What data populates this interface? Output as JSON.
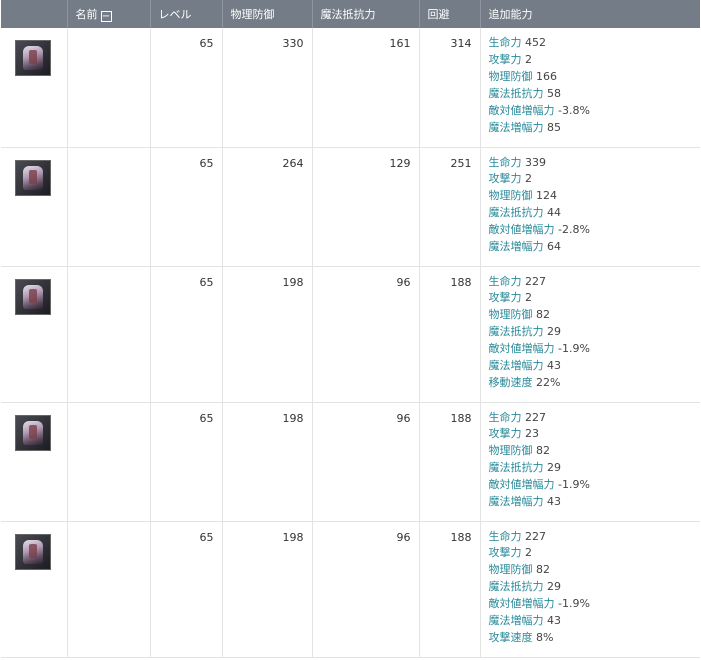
{
  "columns": {
    "name": "名前",
    "level": "レベル",
    "phys_def": "物理防御",
    "mag_res": "魔法抵抗力",
    "evasion": "回避",
    "bonus": "追加能力"
  },
  "toggle_symbol": "−",
  "rows": [
    {
      "icon": "armor-piece-icon",
      "level": "65",
      "phys_def": "330",
      "mag_res": "161",
      "evasion": "314",
      "stats": [
        {
          "k": "生命力",
          "v": "452"
        },
        {
          "k": "攻撃力",
          "v": "2"
        },
        {
          "k": "物理防御",
          "v": "166"
        },
        {
          "k": "魔法抵抗力",
          "v": "58"
        },
        {
          "k": "敵対値増幅力",
          "v": "-3.8%"
        },
        {
          "k": "魔法増幅力",
          "v": "85"
        }
      ]
    },
    {
      "icon": "armor-piece-icon",
      "level": "65",
      "phys_def": "264",
      "mag_res": "129",
      "evasion": "251",
      "stats": [
        {
          "k": "生命力",
          "v": "339"
        },
        {
          "k": "攻撃力",
          "v": "2"
        },
        {
          "k": "物理防御",
          "v": "124"
        },
        {
          "k": "魔法抵抗力",
          "v": "44"
        },
        {
          "k": "敵対値増幅力",
          "v": "-2.8%"
        },
        {
          "k": "魔法増幅力",
          "v": "64"
        }
      ]
    },
    {
      "icon": "armor-piece-icon",
      "level": "65",
      "phys_def": "198",
      "mag_res": "96",
      "evasion": "188",
      "stats": [
        {
          "k": "生命力",
          "v": "227"
        },
        {
          "k": "攻撃力",
          "v": "2"
        },
        {
          "k": "物理防御",
          "v": "82"
        },
        {
          "k": "魔法抵抗力",
          "v": "29"
        },
        {
          "k": "敵対値増幅力",
          "v": "-1.9%"
        },
        {
          "k": "魔法増幅力",
          "v": "43"
        },
        {
          "k": "移動速度",
          "v": "22%"
        }
      ]
    },
    {
      "icon": "armor-piece-icon",
      "level": "65",
      "phys_def": "198",
      "mag_res": "96",
      "evasion": "188",
      "stats": [
        {
          "k": "生命力",
          "v": "227"
        },
        {
          "k": "攻撃力",
          "v": "23"
        },
        {
          "k": "物理防御",
          "v": "82"
        },
        {
          "k": "魔法抵抗力",
          "v": "29"
        },
        {
          "k": "敵対値増幅力",
          "v": "-1.9%"
        },
        {
          "k": "魔法増幅力",
          "v": "43"
        }
      ]
    },
    {
      "icon": "armor-piece-icon",
      "level": "65",
      "phys_def": "198",
      "mag_res": "96",
      "evasion": "188",
      "stats": [
        {
          "k": "生命力",
          "v": "227"
        },
        {
          "k": "攻撃力",
          "v": "2"
        },
        {
          "k": "物理防御",
          "v": "82"
        },
        {
          "k": "魔法抵抗力",
          "v": "29"
        },
        {
          "k": "敵対値増幅力",
          "v": "-1.9%"
        },
        {
          "k": "魔法増幅力",
          "v": "43"
        },
        {
          "k": "攻撃速度",
          "v": "8%"
        }
      ]
    }
  ]
}
